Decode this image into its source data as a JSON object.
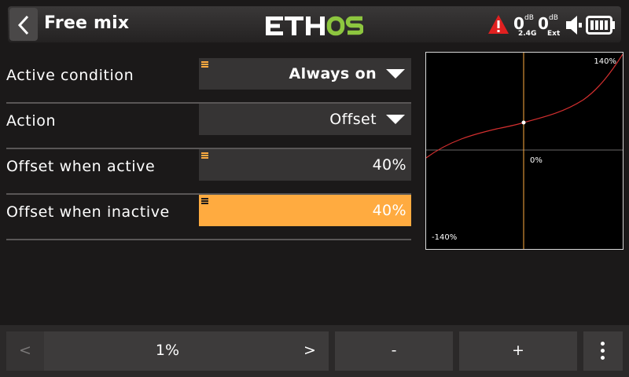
{
  "header": {
    "title": "Free mix",
    "logo_text": "ETHOS",
    "rssi_24_value": "0",
    "rssi_24_unit": "dB",
    "rssi_24_label": "2.4G",
    "rssi_ext_value": "0",
    "rssi_ext_unit": "dB",
    "rssi_ext_label": "Ext",
    "icons": [
      "back-arrow-icon",
      "warning-icon",
      "speaker-icon",
      "battery-icon"
    ],
    "colors": {
      "logo_green": "#8dc63f",
      "warning": "#e02020"
    }
  },
  "form": {
    "rows": [
      {
        "label": "Active condition",
        "value": "Always on",
        "kind": "dropdown"
      },
      {
        "label": "Action",
        "value": "Offset",
        "kind": "dropdown"
      },
      {
        "label": "Offset when active",
        "value": "40%",
        "kind": "value"
      },
      {
        "label": "Offset when inactive",
        "value": "40%",
        "kind": "value",
        "selected": true
      }
    ],
    "accent_color": "#ffab40"
  },
  "curve": {
    "top_label": "140%",
    "center_label": "0%",
    "bottom_label": "-140%",
    "curve_color": "#d32f2f",
    "cursor_color": "#ffab40"
  },
  "bottom": {
    "prev": "<",
    "step": "1%",
    "next": ">",
    "minus": "-",
    "plus": "+"
  }
}
